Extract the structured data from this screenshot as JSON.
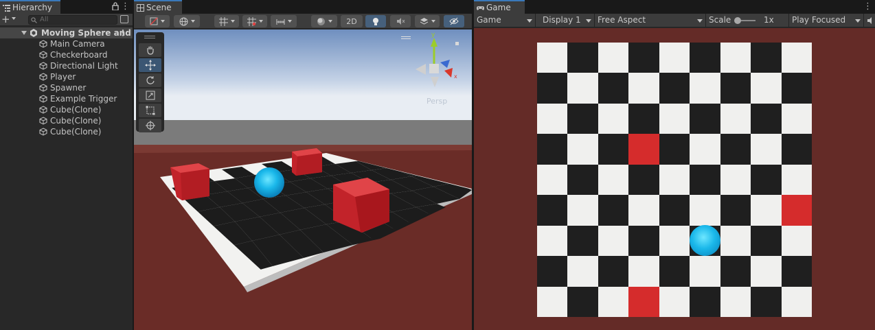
{
  "hierarchy": {
    "tab_label": "Hierarchy",
    "add_label": "+",
    "search_placeholder": "All",
    "root": "Moving Sphere and",
    "items": [
      {
        "label": "Main Camera"
      },
      {
        "label": "Checkerboard"
      },
      {
        "label": "Directional Light"
      },
      {
        "label": "Player"
      },
      {
        "label": "Spawner"
      },
      {
        "label": "Example Trigger"
      },
      {
        "label": "Cube(Clone)"
      },
      {
        "label": "Cube(Clone)"
      },
      {
        "label": "Cube(Clone)"
      }
    ]
  },
  "scene": {
    "tab_label": "Scene",
    "toolbar": {
      "mode_2d": "2D"
    },
    "projection_label": "Persp",
    "tools": [
      "hand-tool",
      "move-tool",
      "rotate-tool",
      "scale-tool",
      "rect-tool",
      "transform-tool"
    ],
    "active_tool": "move-tool"
  },
  "game": {
    "tab_label": "Game",
    "display_mode": "Game",
    "display": "Display 1",
    "aspect": "Free Aspect",
    "scale_label": "Scale",
    "scale_value": "1x",
    "play_mode": "Play Focused"
  },
  "colors": {
    "accent": "#3a79bb",
    "background_game": "#642b27",
    "cube_red": "#d52c2c",
    "sphere_cyan": "#1ab8ea",
    "board_white": "#f0f0ee",
    "board_black": "#1f1f1f"
  },
  "game_board": {
    "size": 9,
    "red_cells": [
      [
        3,
        3
      ],
      [
        5,
        8
      ],
      [
        8,
        3
      ]
    ],
    "sphere_cell": [
      6,
      5
    ]
  }
}
